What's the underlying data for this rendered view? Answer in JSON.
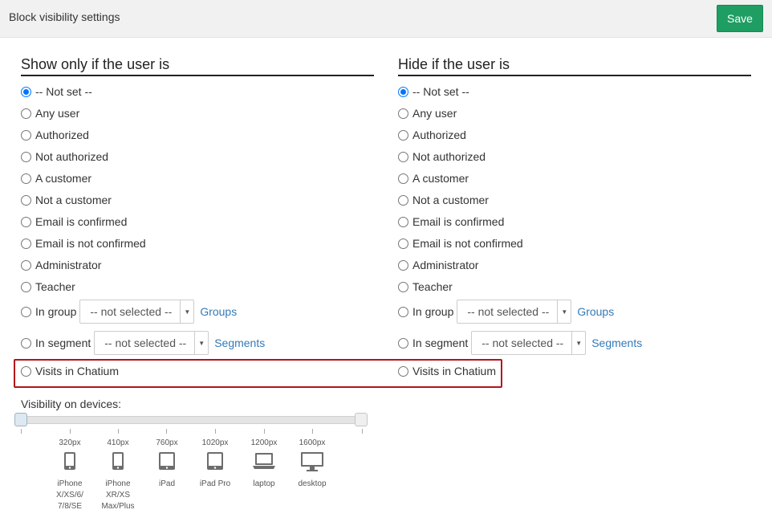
{
  "header": {
    "title": "Block visibility settings",
    "save_label": "Save"
  },
  "columns": [
    {
      "heading": "Show only if the user is",
      "options": [
        "-- Not set --",
        "Any user",
        "Authorized",
        "Not authorized",
        "A customer",
        "Not a customer",
        "Email is confirmed",
        "Email is not confirmed",
        "Administrator",
        "Teacher"
      ],
      "group_label": "In group",
      "group_select": "-- not selected --",
      "group_link": "Groups",
      "segment_label": "In segment",
      "segment_select": "-- not selected --",
      "segment_link": "Segments",
      "visits_label": "Visits in Chatium",
      "selected_index": 0
    },
    {
      "heading": "Hide if the user is",
      "options": [
        "-- Not set --",
        "Any user",
        "Authorized",
        "Not authorized",
        "A customer",
        "Not a customer",
        "Email is confirmed",
        "Email is not confirmed",
        "Administrator",
        "Teacher"
      ],
      "group_label": "In group",
      "group_select": "-- not selected --",
      "group_link": "Groups",
      "segment_label": "In segment",
      "segment_select": "-- not selected --",
      "segment_link": "Segments",
      "visits_label": "Visits in Chatium",
      "selected_index": 0
    }
  ],
  "devices": {
    "label": "Visibility on devices:",
    "items": [
      {
        "px": "320px",
        "name": [
          "iPhone",
          "X/XS/6/",
          "7/8/SE"
        ],
        "icon": "phone-icon"
      },
      {
        "px": "410px",
        "name": [
          "iPhone",
          "XR/XS",
          "Max/Plus"
        ],
        "icon": "phone-icon"
      },
      {
        "px": "760px",
        "name": [
          "iPad"
        ],
        "icon": "tablet-icon"
      },
      {
        "px": "1020px",
        "name": [
          "iPad Pro"
        ],
        "icon": "tablet-icon"
      },
      {
        "px": "1200px",
        "name": [
          "laptop"
        ],
        "icon": "laptop-icon"
      },
      {
        "px": "1600px",
        "name": [
          "desktop"
        ],
        "icon": "desktop-icon"
      }
    ]
  },
  "colors": {
    "save": "#1e9e63",
    "highlight": "#b3141b",
    "link": "#337ab7",
    "radio_checked": "#0075ff"
  }
}
